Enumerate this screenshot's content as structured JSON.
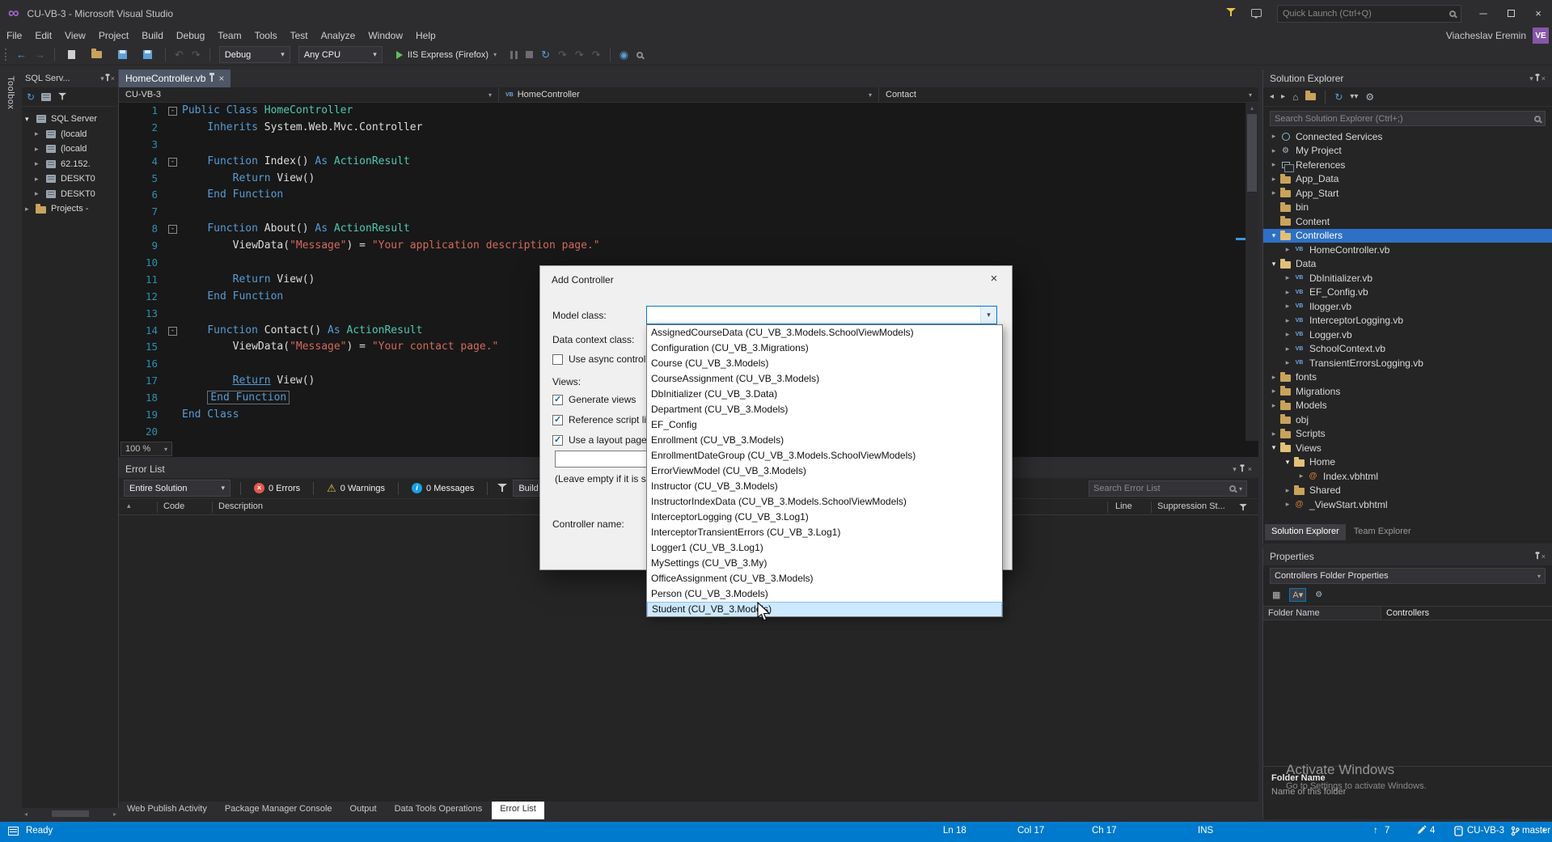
{
  "window": {
    "title": "CU-VB-3 - Microsoft Visual Studio",
    "quick_launch": "Quick Launch (Ctrl+Q)",
    "user": "Viacheslav Eremin",
    "avatar": "VE"
  },
  "menu": [
    "File",
    "Edit",
    "View",
    "Project",
    "Build",
    "Debug",
    "Team",
    "Tools",
    "Test",
    "Analyze",
    "Window",
    "Help"
  ],
  "toolbar": {
    "config": "Debug",
    "platform": "Any CPU",
    "run_target": "IIS Express (Firefox)"
  },
  "left": {
    "strip": "Toolbox",
    "sql": {
      "tab": "SQL Serv...",
      "root": "SQL Server",
      "servers": [
        "(locald",
        "(locald",
        "62.152.",
        "DESKT0",
        "DESKT0"
      ],
      "projects": "Projects -"
    }
  },
  "editor": {
    "tab": "HomeController.vb",
    "crumb_project": "CU-VB-3",
    "crumb_type": "HomeController",
    "crumb_member": "Contact",
    "zoom": "100 %",
    "lines": [
      {
        "n": "1",
        "fold": true,
        "tokens": [
          [
            "k",
            "Public Class"
          ],
          [
            "p",
            " "
          ],
          [
            "t",
            "HomeController"
          ]
        ]
      },
      {
        "n": "2",
        "tokens": [
          [
            "p",
            "    "
          ],
          [
            "k",
            "Inherits"
          ],
          [
            "p",
            " System.Web.Mvc.Controller"
          ]
        ]
      },
      {
        "n": "3",
        "tokens": []
      },
      {
        "n": "4",
        "fold": true,
        "tokens": [
          [
            "p",
            "    "
          ],
          [
            "k",
            "Function"
          ],
          [
            "p",
            " Index() "
          ],
          [
            "k",
            "As"
          ],
          [
            "t",
            " ActionResult"
          ]
        ]
      },
      {
        "n": "5",
        "tokens": [
          [
            "p",
            "        "
          ],
          [
            "k",
            "Return"
          ],
          [
            "p",
            " View()"
          ]
        ]
      },
      {
        "n": "6",
        "tokens": [
          [
            "p",
            "    "
          ],
          [
            "k",
            "End Function"
          ]
        ]
      },
      {
        "n": "7",
        "tokens": []
      },
      {
        "n": "8",
        "fold": true,
        "tokens": [
          [
            "p",
            "    "
          ],
          [
            "k",
            "Function"
          ],
          [
            "p",
            " About() "
          ],
          [
            "k",
            "As"
          ],
          [
            "t",
            " ActionResult"
          ]
        ]
      },
      {
        "n": "9",
        "tokens": [
          [
            "p",
            "        ViewData("
          ],
          [
            "s",
            "\"Message\""
          ],
          [
            "p",
            ") = "
          ],
          [
            "s",
            "\"Your application description page.\""
          ]
        ]
      },
      {
        "n": "10",
        "tokens": []
      },
      {
        "n": "11",
        "tokens": [
          [
            "p",
            "        "
          ],
          [
            "k",
            "Return"
          ],
          [
            "p",
            " View()"
          ]
        ]
      },
      {
        "n": "12",
        "tokens": [
          [
            "p",
            "    "
          ],
          [
            "k",
            "End Function"
          ]
        ]
      },
      {
        "n": "13",
        "tokens": []
      },
      {
        "n": "14",
        "fold": true,
        "tokens": [
          [
            "p",
            "    "
          ],
          [
            "k",
            "Function"
          ],
          [
            "p",
            " Contact() "
          ],
          [
            "k",
            "As"
          ],
          [
            "t",
            " ActionResult"
          ]
        ]
      },
      {
        "n": "15",
        "tokens": [
          [
            "p",
            "        ViewData("
          ],
          [
            "s",
            "\"Message\""
          ],
          [
            "p",
            ") = "
          ],
          [
            "s",
            "\"Your contact page.\""
          ]
        ]
      },
      {
        "n": "16",
        "tokens": []
      },
      {
        "n": "17",
        "tokens": [
          [
            "p",
            "        "
          ],
          [
            "ku",
            "Return"
          ],
          [
            "p",
            " View()"
          ]
        ]
      },
      {
        "n": "18",
        "boxed": true,
        "tokens": [
          [
            "p",
            "    "
          ],
          [
            "k",
            "End Function"
          ]
        ]
      },
      {
        "n": "19",
        "tokens": [
          [
            "k",
            "End Class"
          ]
        ]
      },
      {
        "n": "20",
        "tokens": []
      }
    ]
  },
  "dialog": {
    "title": "Add Controller",
    "model_class": "Model class:",
    "data_context": "Data context class:",
    "use_async": "Use async controller actions",
    "views": "Views:",
    "generate_views": "Generate views",
    "reference_scripts": "Reference script libraries",
    "use_layout": "Use a layout page:",
    "leave_empty": "(Leave empty if it is set in a Razor _viewstart file)",
    "controller_name": "Controller name:",
    "model_options": [
      {
        "label": "AssignedCourseData (CU_VB_3.Models.SchoolViewModels)"
      },
      {
        "label": "Configuration (CU_VB_3.Migrations)"
      },
      {
        "label": "Course (CU_VB_3.Models)"
      },
      {
        "label": "CourseAssignment (CU_VB_3.Models)"
      },
      {
        "label": "DbInitializer (CU_VB_3.Data)"
      },
      {
        "label": "Department (CU_VB_3.Models)"
      },
      {
        "label": "EF_Config"
      },
      {
        "label": "Enrollment (CU_VB_3.Models)"
      },
      {
        "label": "EnrollmentDateGroup (CU_VB_3.Models.SchoolViewModels)"
      },
      {
        "label": "ErrorViewModel (CU_VB_3.Models)"
      },
      {
        "label": "Instructor (CU_VB_3.Models)"
      },
      {
        "label": "InstructorIndexData (CU_VB_3.Models.SchoolViewModels)"
      },
      {
        "label": "InterceptorLogging (CU_VB_3.Log1)"
      },
      {
        "label": "InterceptorTransientErrors (CU_VB_3.Log1)"
      },
      {
        "label": "Logger1 (CU_VB_3.Log1)"
      },
      {
        "label": "MySettings (CU_VB_3.My)"
      },
      {
        "label": "OfficeAssignment (CU_VB_3.Models)"
      },
      {
        "label": "Person (CU_VB_3.Models)"
      },
      {
        "label": "Student (CU_VB_3.Models)",
        "selected": true
      }
    ]
  },
  "error_list": {
    "title": "Error List",
    "scope": "Entire Solution",
    "errors": "0 Errors",
    "warnings": "0 Warnings",
    "messages": "0 Messages",
    "build_filter": "Build + IntelliSense",
    "search_placeholder": "Search Error List",
    "columns": {
      "code": "Code",
      "description": "Description",
      "line": "Line",
      "suppression": "Suppression St..."
    }
  },
  "bottom_tabs": [
    {
      "label": "Web Publish Activity"
    },
    {
      "label": "Package Manager Console"
    },
    {
      "label": "Output"
    },
    {
      "label": "Data Tools Operations"
    },
    {
      "label": "Error List",
      "active": true
    }
  ],
  "solution_explorer": {
    "title": "Solution Explorer",
    "search_placeholder": "Search Solution Explorer (Ctrl+;)",
    "tabs": [
      {
        "label": "Solution Explorer",
        "active": true
      },
      {
        "label": "Team Explorer"
      }
    ],
    "tree": [
      {
        "label": "Connected Services",
        "indent": 1,
        "icon": "services",
        "arrow": "right"
      },
      {
        "label": "My Project",
        "indent": 1,
        "icon": "myproject",
        "arrow": "right"
      },
      {
        "label": "References",
        "indent": 1,
        "icon": "references",
        "arrow": "right"
      },
      {
        "label": "App_Data",
        "indent": 1,
        "icon": "folder",
        "arrow": "right"
      },
      {
        "label": "App_Start",
        "indent": 1,
        "icon": "folder",
        "arrow": "right"
      },
      {
        "label": "bin",
        "indent": 1,
        "icon": "folder",
        "arrow": "none"
      },
      {
        "label": "Content",
        "indent": 1,
        "icon": "folder",
        "arrow": "none"
      },
      {
        "label": "Controllers",
        "indent": 1,
        "icon": "folder-open",
        "arrow": "down",
        "selected": true
      },
      {
        "label": "HomeController.vb",
        "indent": 2,
        "icon": "vb",
        "arrow": "right"
      },
      {
        "label": "Data",
        "indent": 1,
        "icon": "folder-open",
        "arrow": "down"
      },
      {
        "label": "DbInitializer.vb",
        "indent": 2,
        "icon": "vb",
        "arrow": "right"
      },
      {
        "label": "EF_Config.vb",
        "indent": 2,
        "icon": "vb",
        "arrow": "right"
      },
      {
        "label": "Ilogger.vb",
        "indent": 2,
        "icon": "vb",
        "arrow": "right"
      },
      {
        "label": "InterceptorLogging.vb",
        "indent": 2,
        "icon": "vb",
        "arrow": "right"
      },
      {
        "label": "Logger.vb",
        "indent": 2,
        "icon": "vb",
        "arrow": "right"
      },
      {
        "label": "SchoolContext.vb",
        "indent": 2,
        "icon": "vb",
        "arrow": "right"
      },
      {
        "label": "TransientErrorsLogging.vb",
        "indent": 2,
        "icon": "vb",
        "arrow": "right"
      },
      {
        "label": "fonts",
        "indent": 1,
        "icon": "folder",
        "arrow": "right"
      },
      {
        "label": "Migrations",
        "indent": 1,
        "icon": "folder",
        "arrow": "right"
      },
      {
        "label": "Models",
        "indent": 1,
        "icon": "folder",
        "arrow": "right"
      },
      {
        "label": "obj",
        "indent": 1,
        "icon": "folder",
        "arrow": "none"
      },
      {
        "label": "Scripts",
        "indent": 1,
        "icon": "folder",
        "arrow": "right"
      },
      {
        "label": "Views",
        "indent": 1,
        "icon": "folder-open",
        "arrow": "down"
      },
      {
        "label": "Home",
        "indent": 2,
        "icon": "folder-open",
        "arrow": "down"
      },
      {
        "label": "Index.vbhtml",
        "indent": 3,
        "icon": "razor",
        "arrow": "right"
      },
      {
        "label": "Shared",
        "indent": 2,
        "icon": "folder",
        "arrow": "right"
      },
      {
        "label": "_ViewStart.vbhtml",
        "indent": 2,
        "icon": "razor",
        "arrow": "right"
      }
    ]
  },
  "properties": {
    "title": "Properties",
    "object": "Controllers Folder Properties",
    "grid_name": "Folder Name",
    "grid_value": "Controllers",
    "help_title": "Folder Name",
    "help_text": "Name of this folder"
  },
  "status": {
    "ready": "Ready",
    "ln": "Ln 18",
    "col": "Col 17",
    "ch": "Ch 17",
    "ins": "INS",
    "pushes": "7",
    "edits": "4",
    "repo": "CU-VB-3",
    "branch": "master"
  },
  "watermark": {
    "line1": "Activate Windows",
    "line2": "Go to Settings to activate Windows."
  }
}
